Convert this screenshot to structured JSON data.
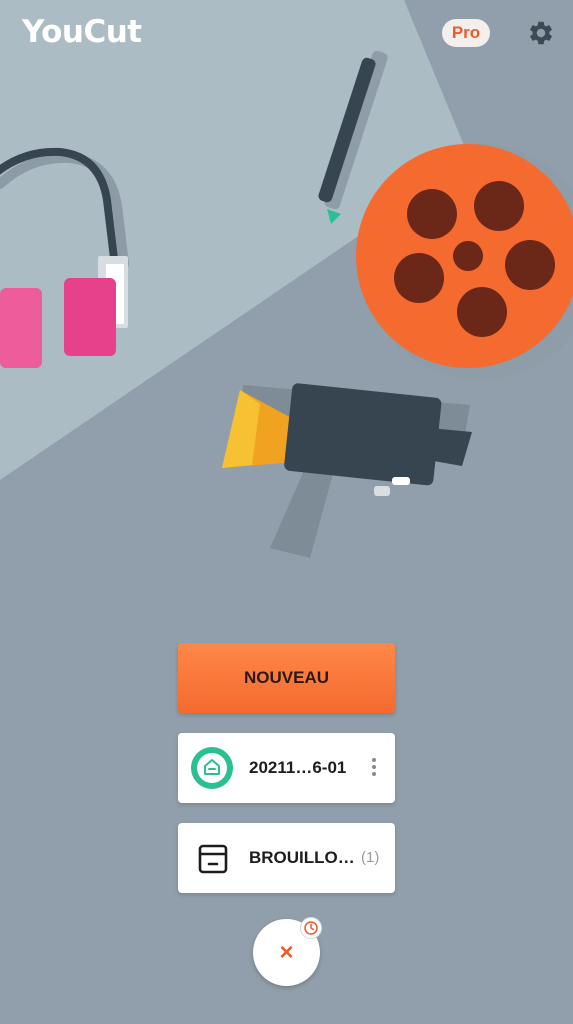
{
  "app": {
    "title": "YouCut",
    "pro_badge": "Pro"
  },
  "icons": {
    "settings": "gear-icon",
    "project": "home-icon",
    "drafts": "drafts-box-icon",
    "more": "more-vertical-icon",
    "close": "close-icon",
    "history": "clock-icon"
  },
  "actions": {
    "new_label": "NOUVEAU"
  },
  "recent_project": {
    "name": "20211…6-01"
  },
  "drafts": {
    "label": "BROUILLO…",
    "count": "(1)"
  },
  "fab": {
    "label": "×"
  },
  "colors": {
    "accent": "#f46a2f",
    "background_light": "#acbcc4",
    "background_dark": "#909fab",
    "project_badge": "#2bbf94"
  }
}
